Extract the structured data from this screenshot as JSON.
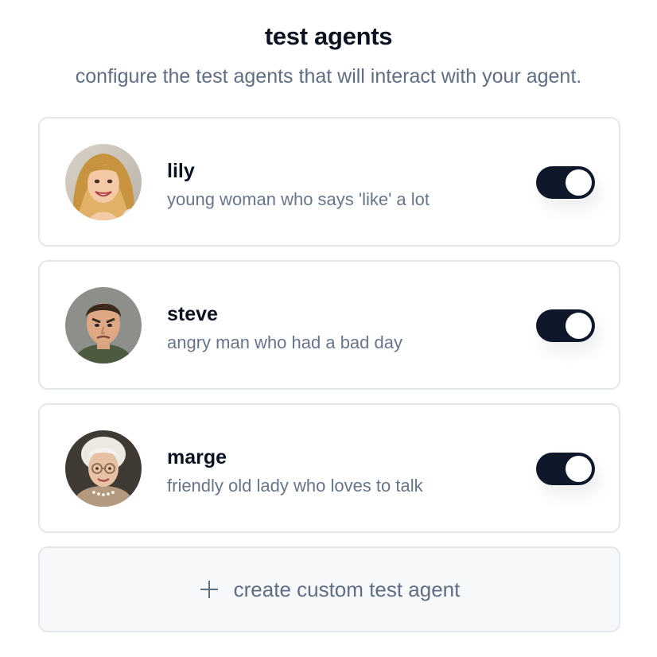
{
  "header": {
    "title": "test agents",
    "subtitle": "configure the test agents that will interact with your agent."
  },
  "agents": [
    {
      "name": "lily",
      "description": "young woman who says 'like' a lot",
      "enabled": true,
      "avatar_icon": "lily-avatar"
    },
    {
      "name": "steve",
      "description": "angry man who had a bad day",
      "enabled": true,
      "avatar_icon": "steve-avatar"
    },
    {
      "name": "marge",
      "description": "friendly old lady who loves to talk",
      "enabled": true,
      "avatar_icon": "marge-avatar"
    }
  ],
  "create_button": {
    "label": "create custom test agent",
    "icon": "plus-icon"
  },
  "colors": {
    "toggle_on": "#0f172a",
    "text_primary": "#0b1221",
    "text_muted": "#66758a",
    "border": "#e3e6eb",
    "create_bg": "#f7f8fa"
  }
}
